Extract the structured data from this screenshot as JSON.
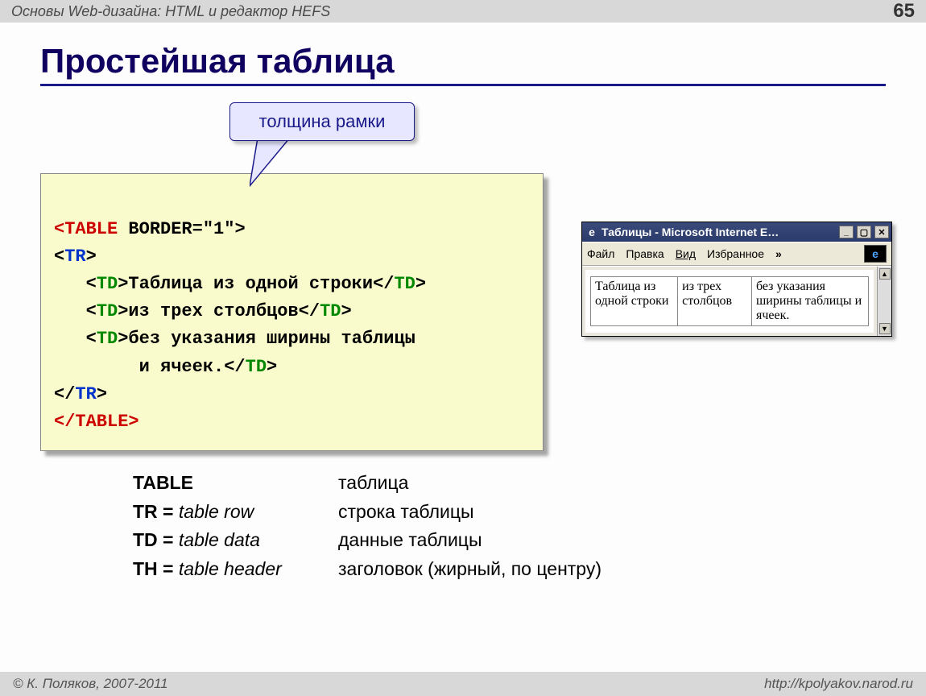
{
  "topbar": {
    "title": "Основы Web-дизайна: HTML и редактор HEFS",
    "page_number": "65"
  },
  "slide": {
    "title": "Простейшая таблица",
    "callout_label": "толщина рамки"
  },
  "code": {
    "line1": {
      "a": "<TABLE",
      "b": " BORDER=\"1\">"
    },
    "line2": {
      "a": "<",
      "b": "TR",
      "c": ">"
    },
    "line3": {
      "a": "   <",
      "b": "TD",
      "c": ">",
      "d": "Таблица из одной строки",
      "e": "</",
      "f": "TD",
      "g": ">"
    },
    "line4": {
      "a": "   <",
      "b": "TD",
      "c": ">",
      "d": "из трех столбцов",
      "e": "</",
      "f": "TD",
      "g": ">"
    },
    "line5": {
      "a": "   <",
      "b": "TD",
      "c": ">",
      "d": "без указания ширины таблицы"
    },
    "line6": {
      "a": "        и ячеек.",
      "b": "</",
      "c": "TD",
      "d": ">"
    },
    "line7": {
      "a": "</",
      "b": "TR",
      "c": ">"
    },
    "line8": {
      "a": "</TABLE>"
    }
  },
  "glossary": [
    {
      "term_bold": "TABLE",
      "term_eq": "",
      "term_italic": "",
      "def": "таблица"
    },
    {
      "term_bold": "TR",
      "term_eq": " = ",
      "term_italic": "table row",
      "def": "строка таблицы"
    },
    {
      "term_bold": "TD",
      "term_eq": " = ",
      "term_italic": "table data",
      "def": "данные таблицы"
    },
    {
      "term_bold": "TH",
      "term_eq": " = ",
      "term_italic": "table header",
      "def": "заголовок (жирный, по центру)"
    }
  ],
  "ie": {
    "title": "Таблицы - Microsoft Internet E…",
    "menu": {
      "file": "Файл",
      "edit": "Правка",
      "view": "Вид",
      "fav": "Избранное",
      "more": "»"
    },
    "cells": [
      "Таблица из одной строки",
      "из трех столбцов",
      "без указания ширины таблицы и ячеек."
    ]
  },
  "footer": {
    "left": "© К. Поляков, 2007-2011",
    "right": "http://kpolyakov.narod.ru"
  }
}
